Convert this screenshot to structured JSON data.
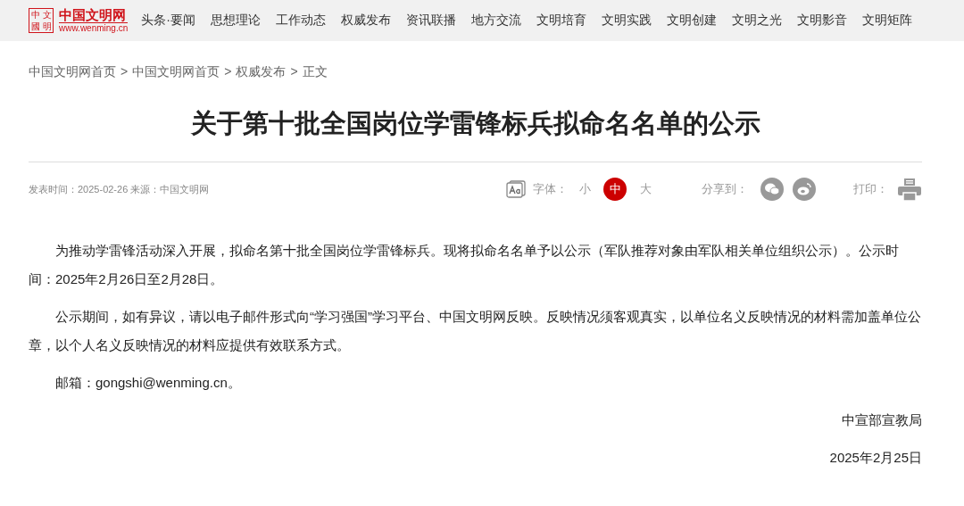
{
  "header": {
    "logo": {
      "seal": [
        "中",
        "文",
        "國",
        "明"
      ],
      "name": "中国文明网",
      "url": "www.wenming.cn"
    },
    "nav": [
      "头条·要闻",
      "思想理论",
      "工作动态",
      "权威发布",
      "资讯联播",
      "地方交流",
      "文明培育",
      "文明实践",
      "文明创建",
      "文明之光",
      "文明影音",
      "文明矩阵"
    ]
  },
  "breadcrumb": [
    "中国文明网首页",
    "中国文明网首页",
    "权威发布",
    "正文"
  ],
  "breadcrumb_separator": ">",
  "article": {
    "title": "关于第十批全国岗位学雷锋标兵拟命名名单的公示",
    "meta": "发表时间：2025-02-26 来源：中国文明网",
    "font_label": "字体：",
    "font_sizes": [
      {
        "label": "小",
        "selected": false
      },
      {
        "label": "中",
        "selected": true
      },
      {
        "label": "大",
        "selected": false
      }
    ],
    "share_label": "分享到：",
    "print_label": "打印：",
    "paragraphs": [
      "为推动学雷锋活动深入开展，拟命名第十批全国岗位学雷锋标兵。现将拟命名名单予以公示（军队推荐对象由军队相关单位组织公示）。公示时间：2025年2月26日至2月28日。",
      "公示期间，如有异议，请以电子邮件形式向“学习强国”学习平台、中国文明网反映。反映情况须客观真实，以单位名义反映情况的材料需加盖单位公章，以个人名义反映情况的材料应提供有效联系方式。",
      "邮箱：gongshi@wenming.cn。"
    ],
    "signature": "中宣部宣教局",
    "date": "2025年2月25日"
  }
}
